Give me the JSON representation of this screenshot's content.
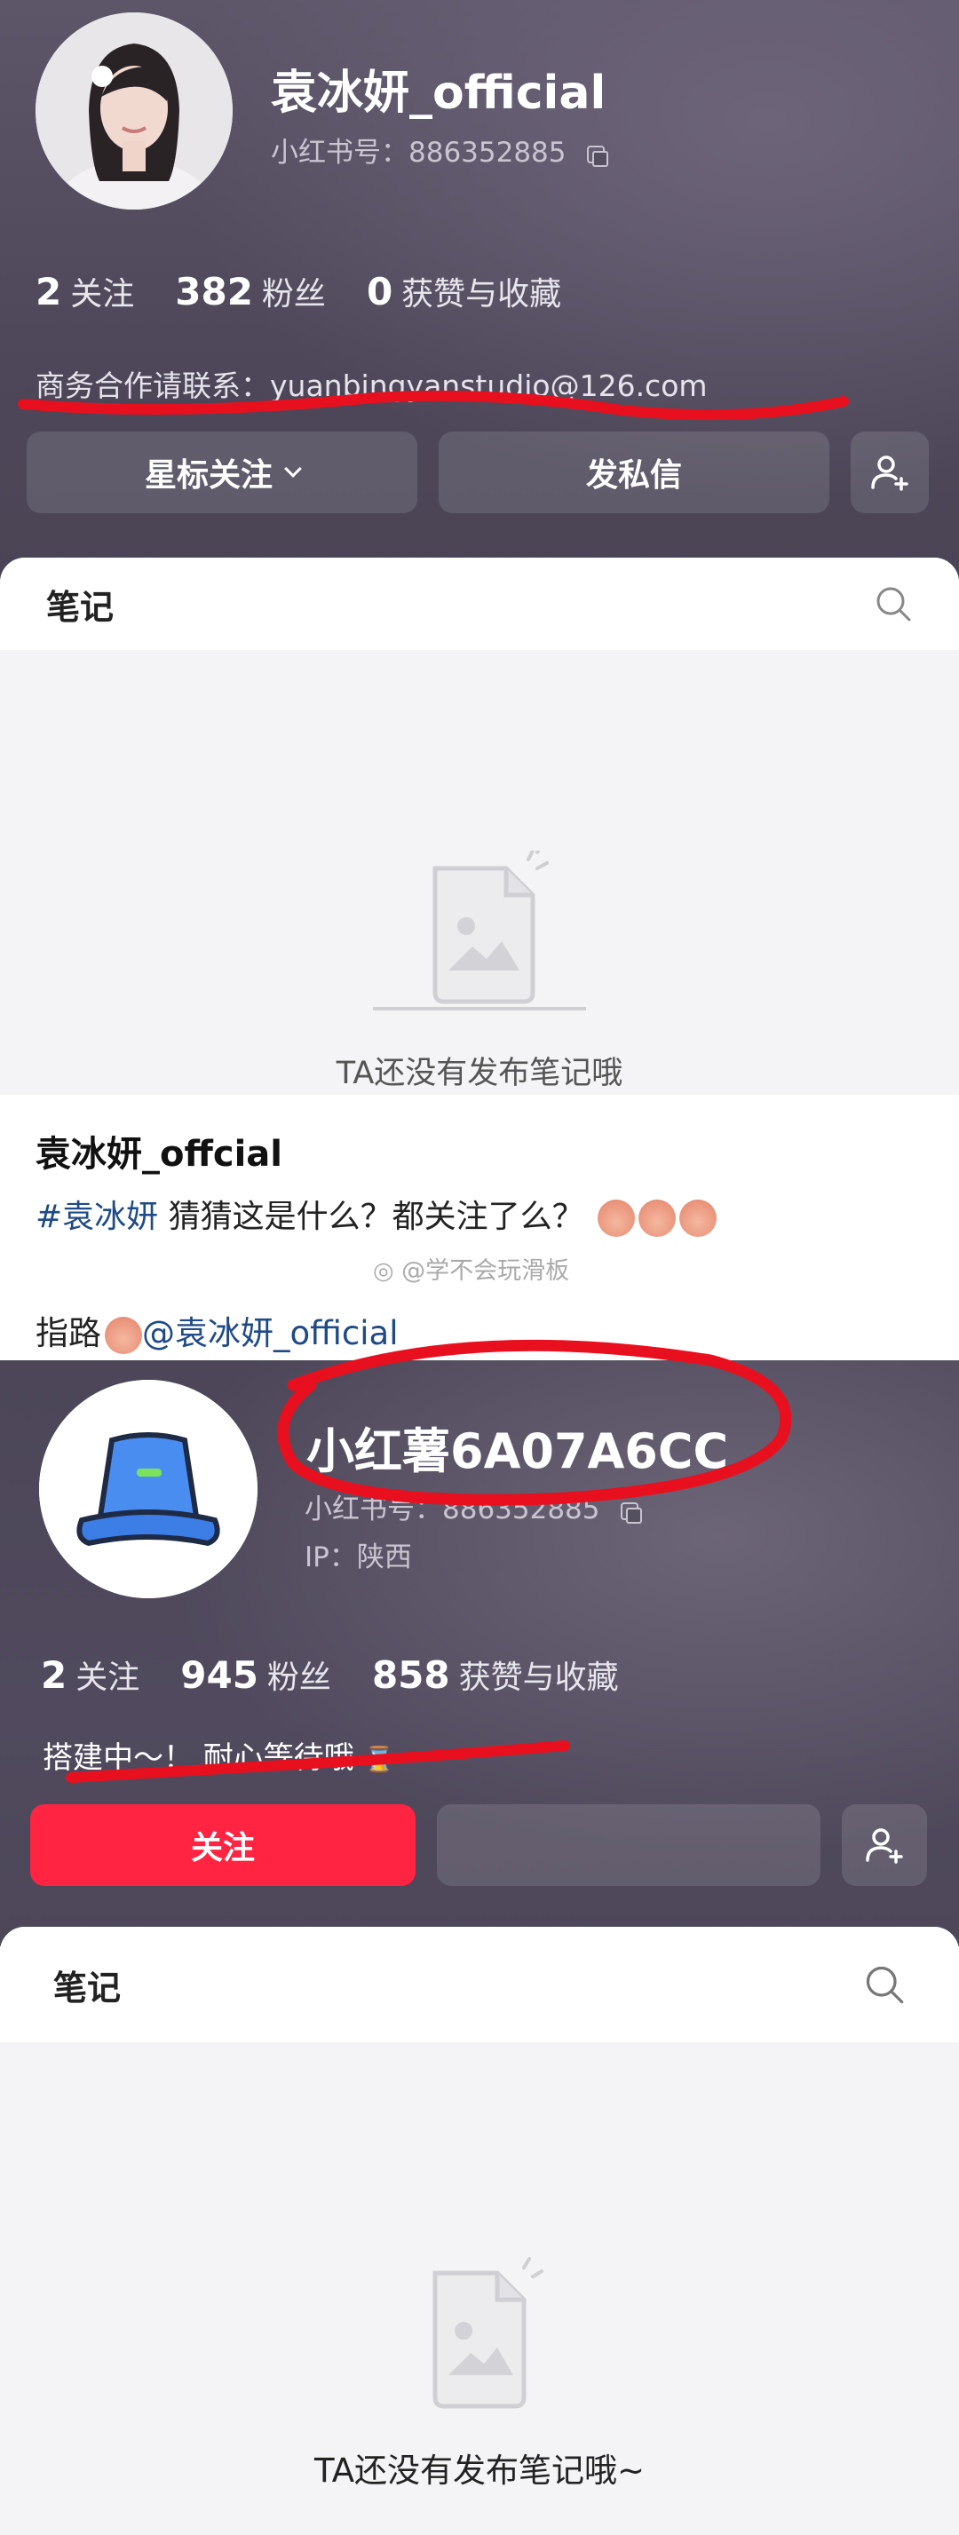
{
  "profile1": {
    "name": "袁冰妍_official",
    "id_line": "小红书号：886352885",
    "stats": [
      {
        "num": "2",
        "label": "关注"
      },
      {
        "num": "382",
        "label": "粉丝"
      },
      {
        "num": "0",
        "label": "获赞与收藏"
      }
    ],
    "bio": "商务合作请联系：yuanbingyanstudio@126.com",
    "buttons": {
      "star_follow": "星标关注",
      "message": "发私信"
    }
  },
  "notes1": {
    "tab": "笔记",
    "empty": "TA还没有发布笔记哦"
  },
  "post": {
    "author": "袁冰妍_offcial",
    "hashtag": "#袁冰妍",
    "text": " 猜猜这是什么？都关注了么？",
    "watermark": "@学不会玩滑板",
    "link_prefix": "指路",
    "mention": "@袁冰妍_official"
  },
  "profile2": {
    "name": "小红薯6A07A6CC",
    "id_line": "小红书号：886352885",
    "ip": "IP：陕西",
    "stats": [
      {
        "num": "2",
        "label": "关注"
      },
      {
        "num": "945",
        "label": "粉丝"
      },
      {
        "num": "858",
        "label": "获赞与收藏"
      }
    ],
    "bio": "搭建中～！ 耐心等待哦",
    "buttons": {
      "follow": "关注"
    }
  },
  "notes2": {
    "tab": "笔记",
    "empty": "TA还没有发布笔记哦~"
  },
  "colors": {
    "accent_red": "#ff2442",
    "marker_red": "#e8101e",
    "header_purple": "#4d4759"
  }
}
